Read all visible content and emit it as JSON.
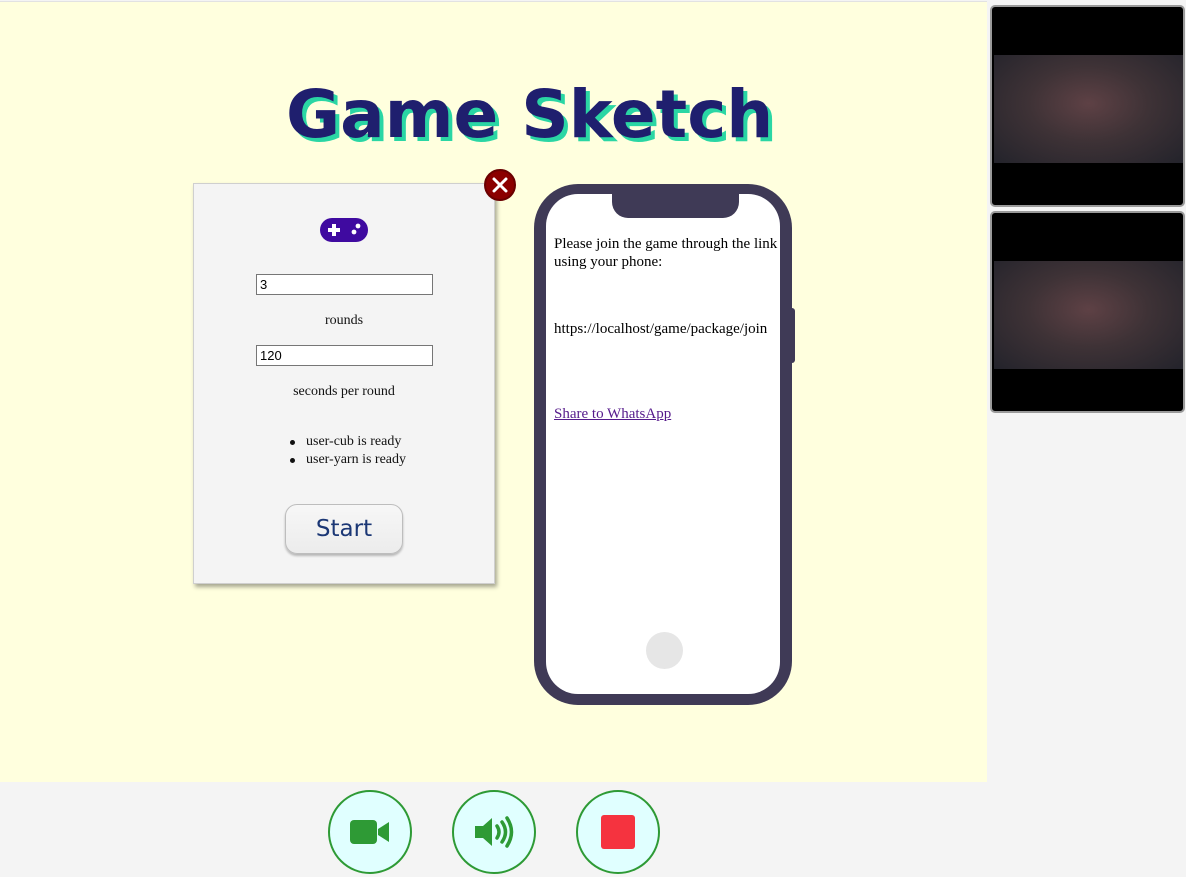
{
  "app": {
    "title": "Game Sketch"
  },
  "settings": {
    "icon": "gamepad-icon",
    "rounds_value": "3",
    "rounds_label": "rounds",
    "seconds_value": "120",
    "seconds_label": "seconds per round",
    "ready_players": [
      "user-cub is ready",
      "user-yarn is ready"
    ],
    "start_label": "Start",
    "close_icon": "close-icon"
  },
  "phone": {
    "instruction": "Please join the game through the link using your phone:",
    "join_url": "https://localhost/game/package/join",
    "share_label": "Share to WhatsApp"
  },
  "video_tiles": [
    {
      "name": "video-tile-1"
    },
    {
      "name": "video-tile-2"
    }
  ],
  "controls": {
    "camera_icon": "video-camera-icon",
    "audio_icon": "speaker-icon",
    "stop_icon": "stop-icon"
  },
  "colors": {
    "page_background": "#ffffde",
    "title": "#1f1f6e",
    "title_shadow": "#2ad6a4",
    "close_button": "#8b0000",
    "gamepad": "#3f0aa0",
    "phone_body": "#3f3a56",
    "control_green": "#2e9a35",
    "stop_red": "#f5333f",
    "link": "#551a8b"
  }
}
